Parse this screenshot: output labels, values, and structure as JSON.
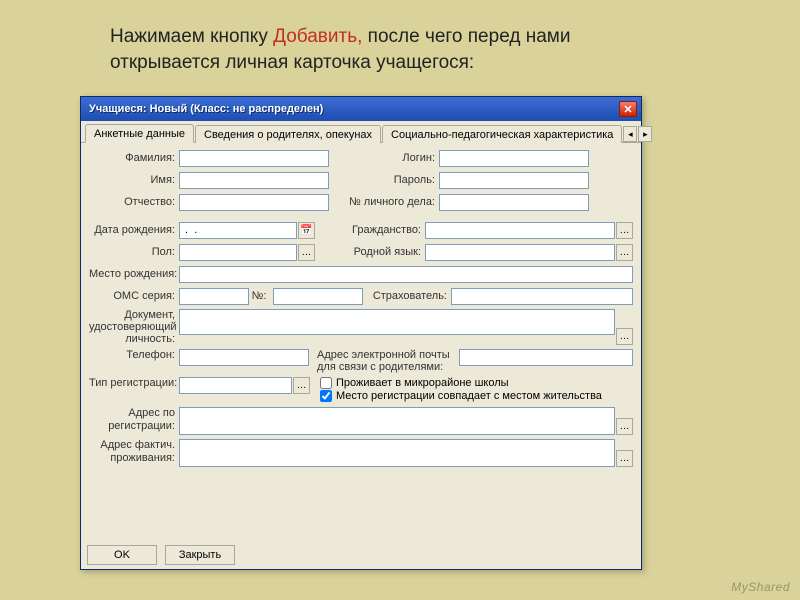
{
  "instruction": {
    "pre": "Нажимаем кнопку ",
    "hl": "Добавить, ",
    "post": "после чего перед нами открывается личная карточка учащегося:"
  },
  "window": {
    "title": "Учащиеся: Новый (Класс: не распределен)"
  },
  "tabs": {
    "t0": "Анкетные данные",
    "t1": "Сведения о родителях, опекунах",
    "t2": "Социально-педагогическая характеристика"
  },
  "labels": {
    "surname": "Фамилия:",
    "name": "Имя:",
    "patronymic": "Отчество:",
    "login": "Логин:",
    "password": "Пароль:",
    "filenum": "№ личного дела:",
    "dob": "Дата рождения:",
    "dob_value": " .  .",
    "citizenship": "Гражданство:",
    "sex": "Пол:",
    "language": "Родной язык:",
    "birthplace": "Место рождения:",
    "oms": "ОМС серия:",
    "omsnum": "№:",
    "insurer": "Страхователь:",
    "iddoc": "Документ, удостоверяющий личность:",
    "phone": "Телефон:",
    "email_hint": "Адрес электронной почты для связи с родителями:",
    "regtype": "Тип регистрации:",
    "cb1": "Проживает в микрорайоне школы",
    "cb2": "Место регистрации совпадает с местом жительства",
    "addr_reg": "Адрес по регистрации:",
    "addr_fact": "Адрес фактич. проживания:"
  },
  "buttons": {
    "ok": "OK",
    "close": "Закрыть"
  },
  "watermark": {
    "prefix": "My",
    "suffix": "Shared"
  }
}
